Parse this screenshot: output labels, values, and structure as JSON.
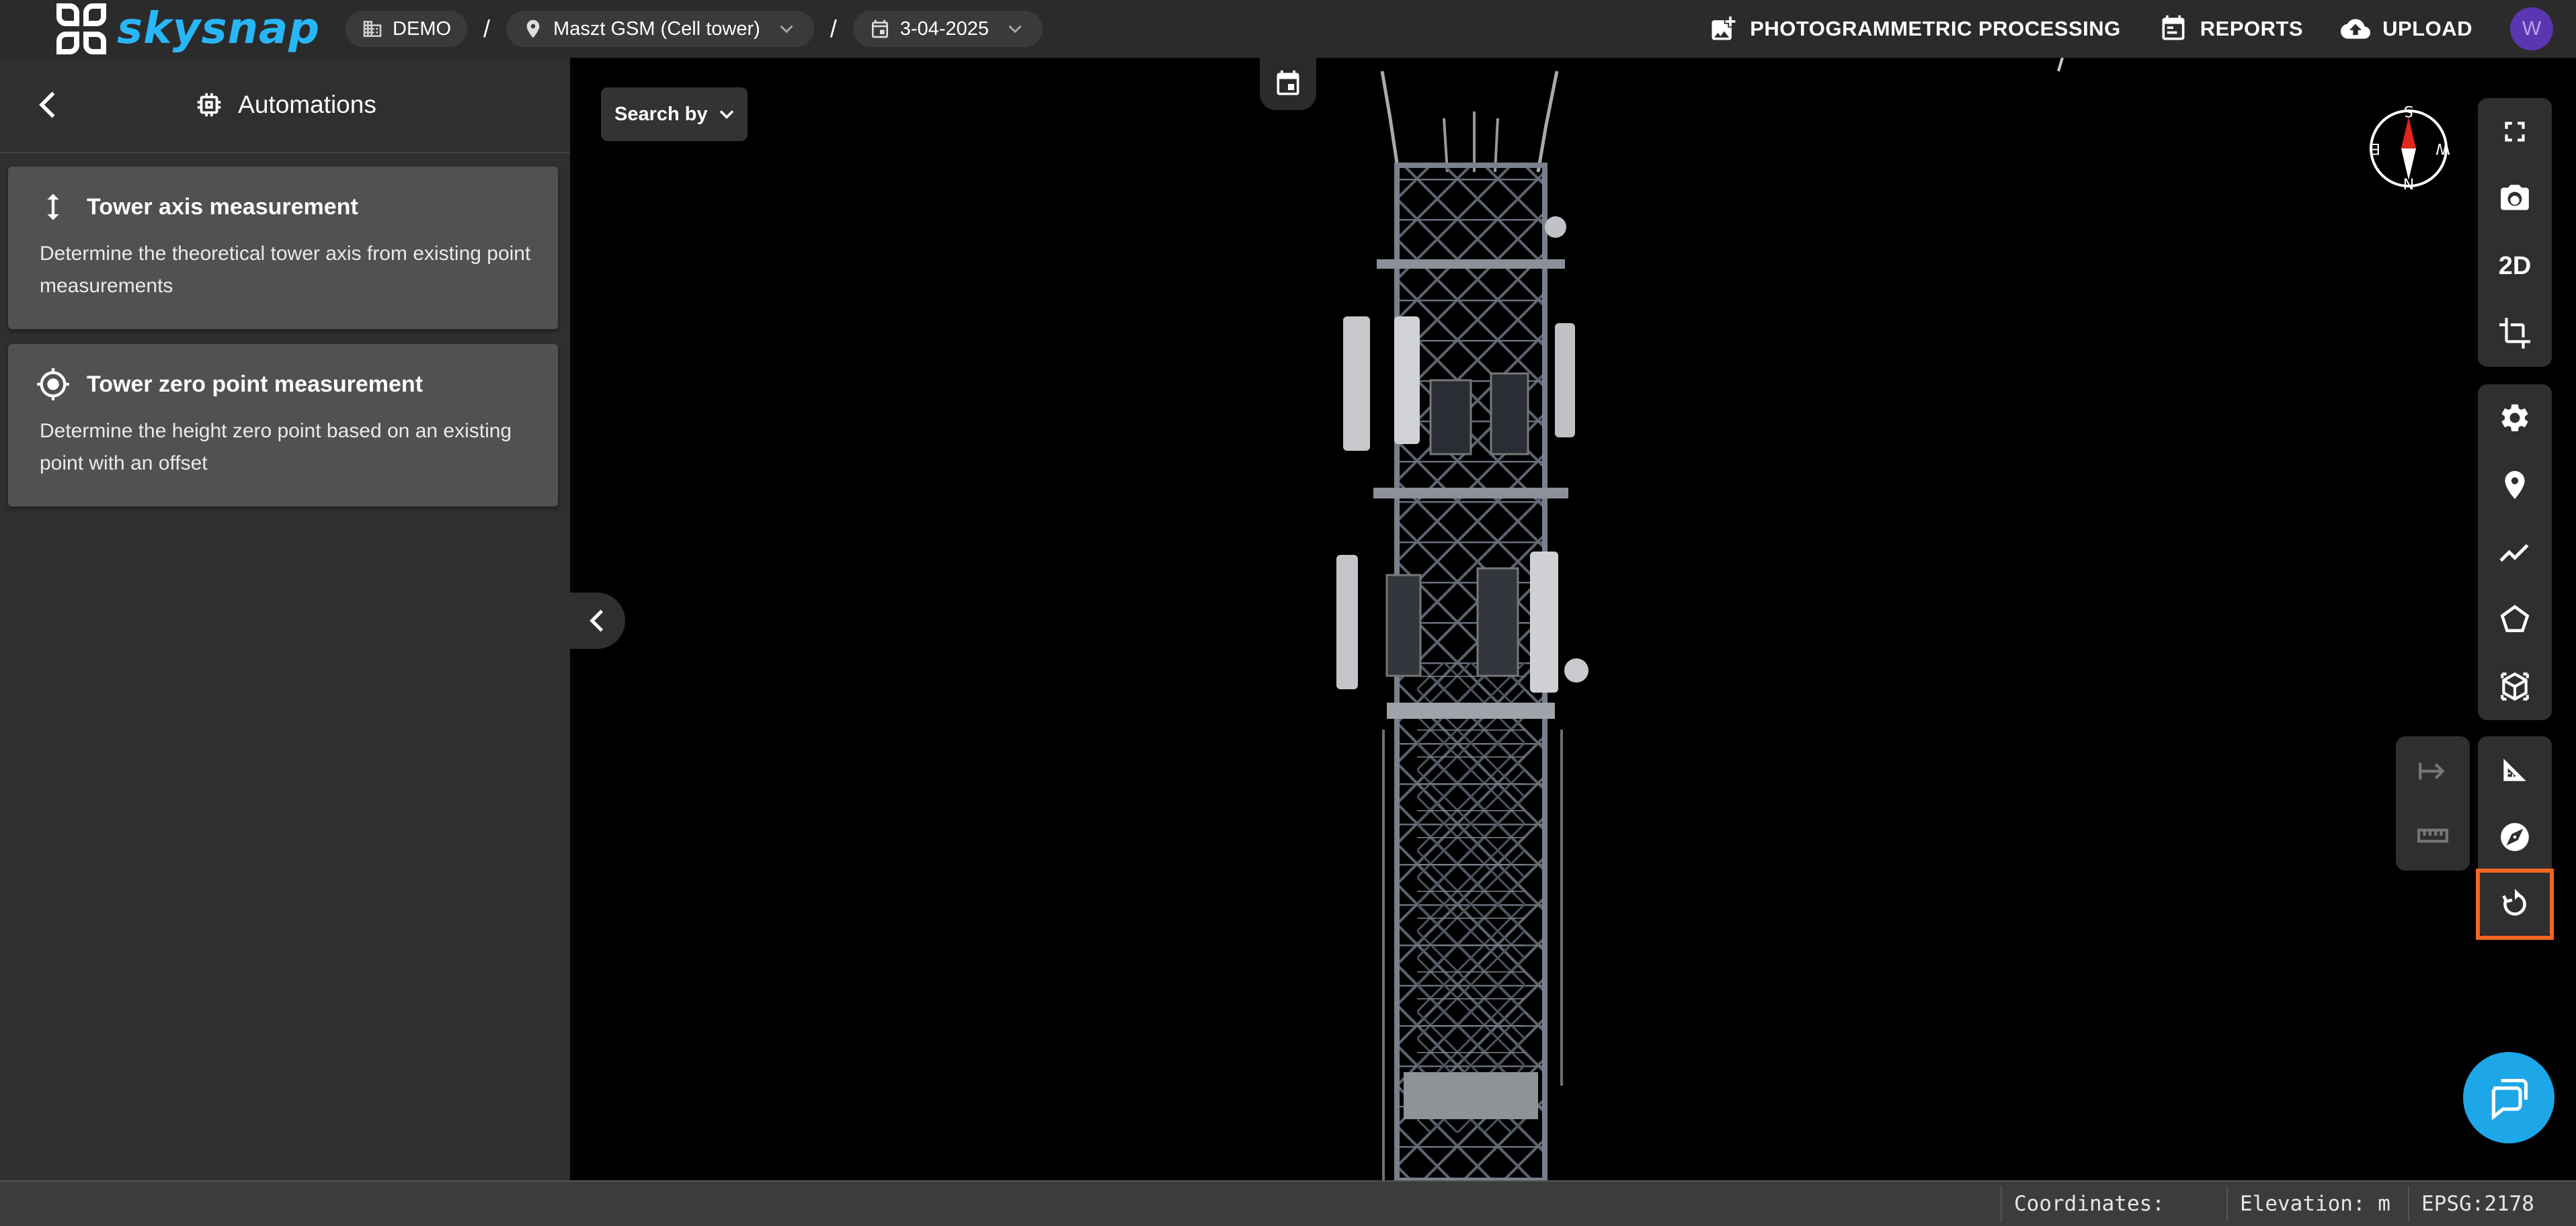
{
  "app": {
    "logo_text": "skysnap"
  },
  "breadcrumb": {
    "org": "DEMO",
    "separator": "/",
    "site": "Maszt GSM (Cell tower)",
    "date": "3-04-2025"
  },
  "top_actions": {
    "photogrammetric": "PHOTOGRAMMETRIC PROCESSING",
    "reports": "REPORTS",
    "upload": "UPLOAD",
    "avatar_initial": "W"
  },
  "panel": {
    "title": "Automations",
    "cards": [
      {
        "title": "Tower axis measurement",
        "description": "Determine the theoretical tower axis from existing point measurements",
        "icon": "vertical-arrows-icon"
      },
      {
        "title": "Tower zero point measurement",
        "description": "Determine the height zero point based on an existing point with an offset",
        "icon": "crosshair-icon"
      }
    ]
  },
  "viewer": {
    "search_by_label": "Search by",
    "compass": {
      "n": "N",
      "s": "S",
      "e": "E",
      "w": "W"
    },
    "tools": {
      "view_2d_label": "2D"
    },
    "highlighted_tool": "rotate-icon"
  },
  "status": {
    "coordinates_label": "Coordinates:",
    "elevation_label": "Elevation: m",
    "epsg_label": "EPSG:2178"
  },
  "colors": {
    "accent": "#29b6f6",
    "highlight": "#f26522",
    "avatar": "#5c35b0",
    "chat": "#1ea7e8"
  }
}
